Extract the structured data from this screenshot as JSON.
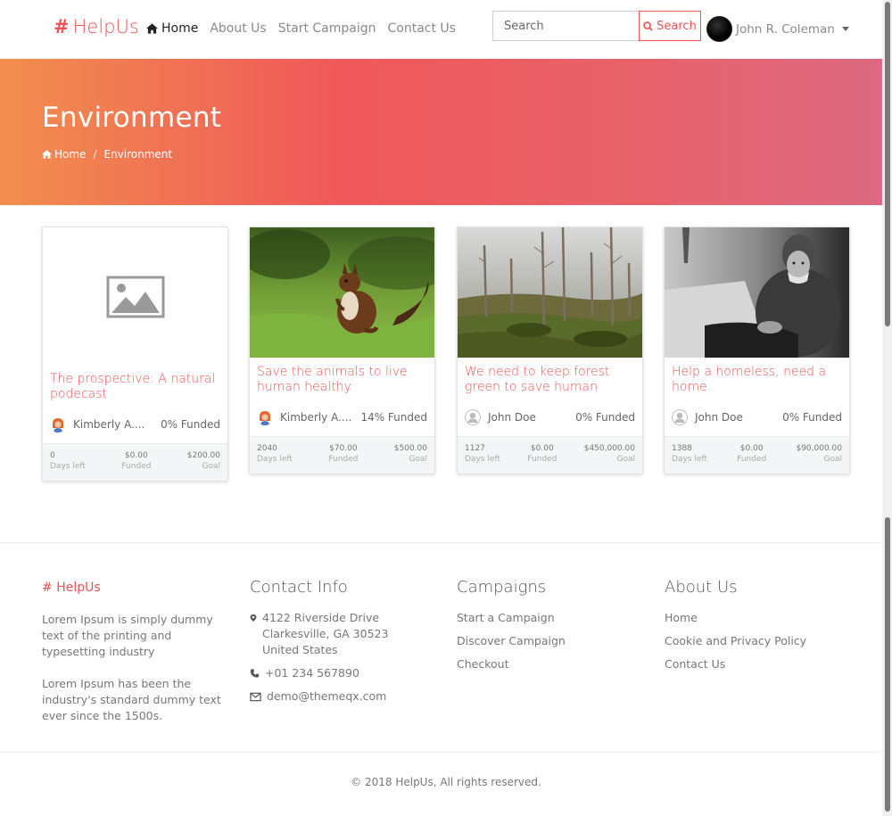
{
  "navbar": {
    "brand": "HelpUs",
    "links": [
      {
        "label": "Home",
        "active": true
      },
      {
        "label": "About Us"
      },
      {
        "label": "Start Campaign"
      },
      {
        "label": "Contact Us"
      }
    ],
    "search": {
      "placeholder": "Search",
      "button_label": "Search"
    },
    "user": {
      "name": "John R. Coleman"
    }
  },
  "hero": {
    "title": "Environment",
    "breadcrumb": {
      "home": "Home",
      "separator": "/",
      "current": "Environment"
    }
  },
  "campaigns": [
    {
      "title": "The prospective: A natural podecast",
      "author": "Kimberly A....",
      "funded_pct": "0% Funded",
      "days_left": "0",
      "days_label": "Days left",
      "funded": "$0.00",
      "funded_label": "Funded",
      "goal": "$200.00",
      "goal_label": "Goal",
      "image": "placeholder-image"
    },
    {
      "title": "Save the animals to live human healthy",
      "author": "Kimberly A....",
      "funded_pct": "14% Funded",
      "days_left": "2040",
      "days_label": "Days left",
      "funded": "$70.00",
      "funded_label": "Funded",
      "goal": "$500.00",
      "goal_label": "Goal",
      "image": "squirrel-photo"
    },
    {
      "title": "We need to keep forest green to save human",
      "author": "John Doe",
      "funded_pct": "0% Funded",
      "days_left": "1127",
      "days_label": "Days left",
      "funded": "$0.00",
      "funded_label": "Funded",
      "goal": "$450,000.00",
      "goal_label": "Goal",
      "image": "dead-forest-photo"
    },
    {
      "title": "Help a homeless, need a home.",
      "author": "John Doe",
      "funded_pct": "0% Funded",
      "days_left": "1388",
      "days_label": "Days left",
      "funded": "$0.00",
      "funded_label": "Funded",
      "goal": "$90,000.00",
      "goal_label": "Goal",
      "image": "homeless-man-photo"
    }
  ],
  "footer": {
    "brand": "HelpUs",
    "about_p1": "Lorem Ipsum is simply dummy text of the printing and typesetting industry",
    "about_p2": "Lorem Ipsum has been the industry's standard dummy text ever since the 1500s.",
    "contact_heading": "Contact Info",
    "address_line1": "4122 Riverside Drive",
    "address_line2": "Clarkesville, GA 30523",
    "address_line3": "United States",
    "phone": "+01 234 567890",
    "email": "demo@themeqx.com",
    "campaigns_heading": "Campaigns",
    "campaign_links": [
      "Start a Campaign",
      "Discover Campaign",
      "Checkout"
    ],
    "about_heading": "About Us",
    "about_links": [
      "Home",
      "Cookie and Privacy Policy",
      "Contact Us"
    ],
    "copyright": "© 2018 HelpUs, All rights reserved."
  },
  "colors": {
    "accent": "#ee5253",
    "hero_start": "#f18e4e",
    "hero_end": "#dc6a82"
  }
}
